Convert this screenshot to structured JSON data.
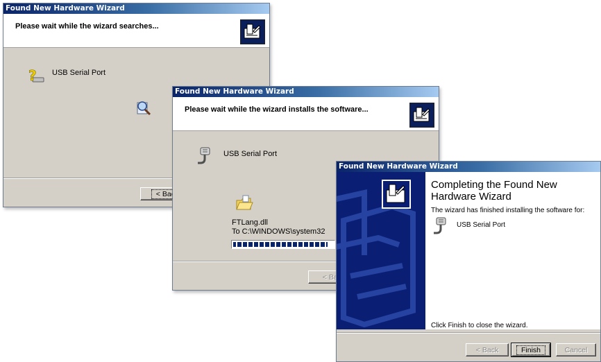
{
  "window1": {
    "title": "Found New Hardware Wizard",
    "header": "Please wait while the wizard searches...",
    "device": "USB Serial Port",
    "back_button": "< Back"
  },
  "window2": {
    "title": "Found New Hardware Wizard",
    "header": "Please wait while the wizard installs the software...",
    "device": "USB Serial Port",
    "file_name": "FTLang.dll",
    "file_dest": "To C:\\WINDOWS\\system32",
    "progress_fraction": 0.93,
    "back_button": "< Back"
  },
  "window3": {
    "title": "Found New Hardware Wizard",
    "heading": "Completing the Found New Hardware Wizard",
    "message": "The wizard has finished installing the software for:",
    "device": "USB Serial Port",
    "close_hint": "Click Finish to close the wizard.",
    "back_button": "< Back",
    "finish_button": "Finish",
    "cancel_button": "Cancel"
  },
  "colors": {
    "titlebar_start": "#0a246a",
    "dialog_gray": "#d4d0c8",
    "side_panel": "#0a1f73"
  }
}
